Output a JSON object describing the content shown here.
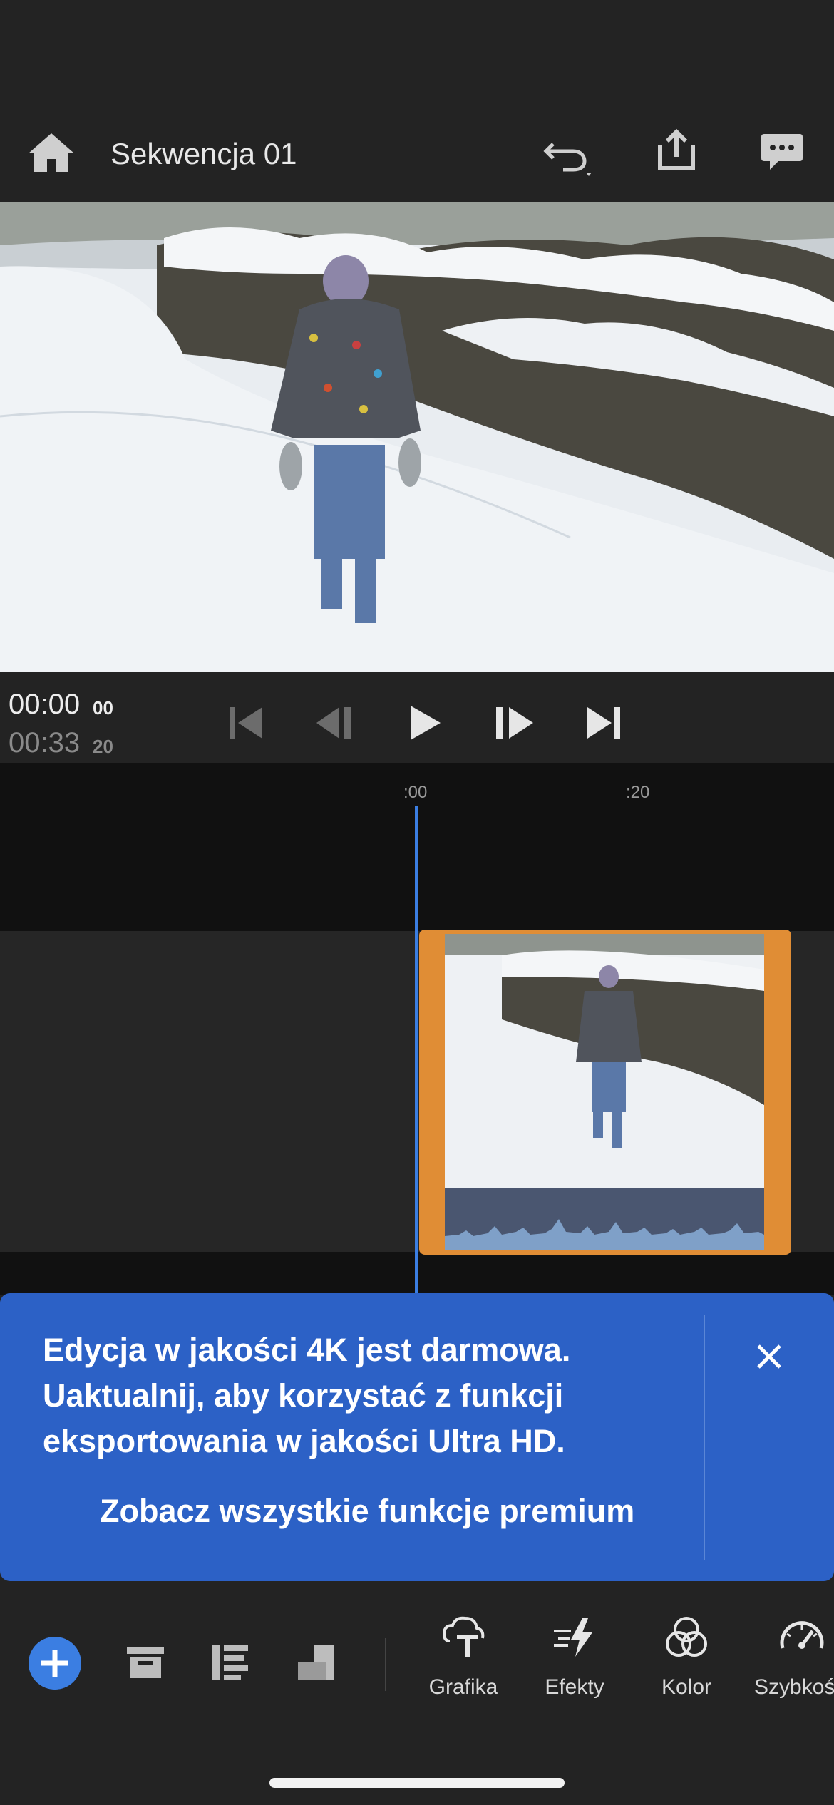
{
  "header": {
    "title": "Sekwencja 01",
    "icons": [
      "home-icon",
      "undo-icon",
      "share-icon",
      "comment-icon"
    ]
  },
  "transport": {
    "current_time": "00:00",
    "current_frames": "00",
    "total_time": "00:33",
    "total_frames": "20"
  },
  "timeline": {
    "ruler_labels": [
      ":00",
      ":20"
    ]
  },
  "banner": {
    "message": "Edycja w jakości 4K jest darmowa. Uaktualnij, aby korzystać z funkcji eksportowania w jakości Ultra HD.",
    "link": "Zobacz wszystkie funkcje premium"
  },
  "toolbar": {
    "tools": [
      {
        "label": "Grafika",
        "icon": "graphics-icon"
      },
      {
        "label": "Efekty",
        "icon": "effects-icon"
      },
      {
        "label": "Kolor",
        "icon": "color-icon"
      },
      {
        "label": "Szybkoś",
        "icon": "speed-icon"
      }
    ]
  },
  "colors": {
    "accent": "#3b7ee2",
    "banner": "#2c61c6",
    "clip_border": "#e08d35",
    "background": "#232323"
  }
}
